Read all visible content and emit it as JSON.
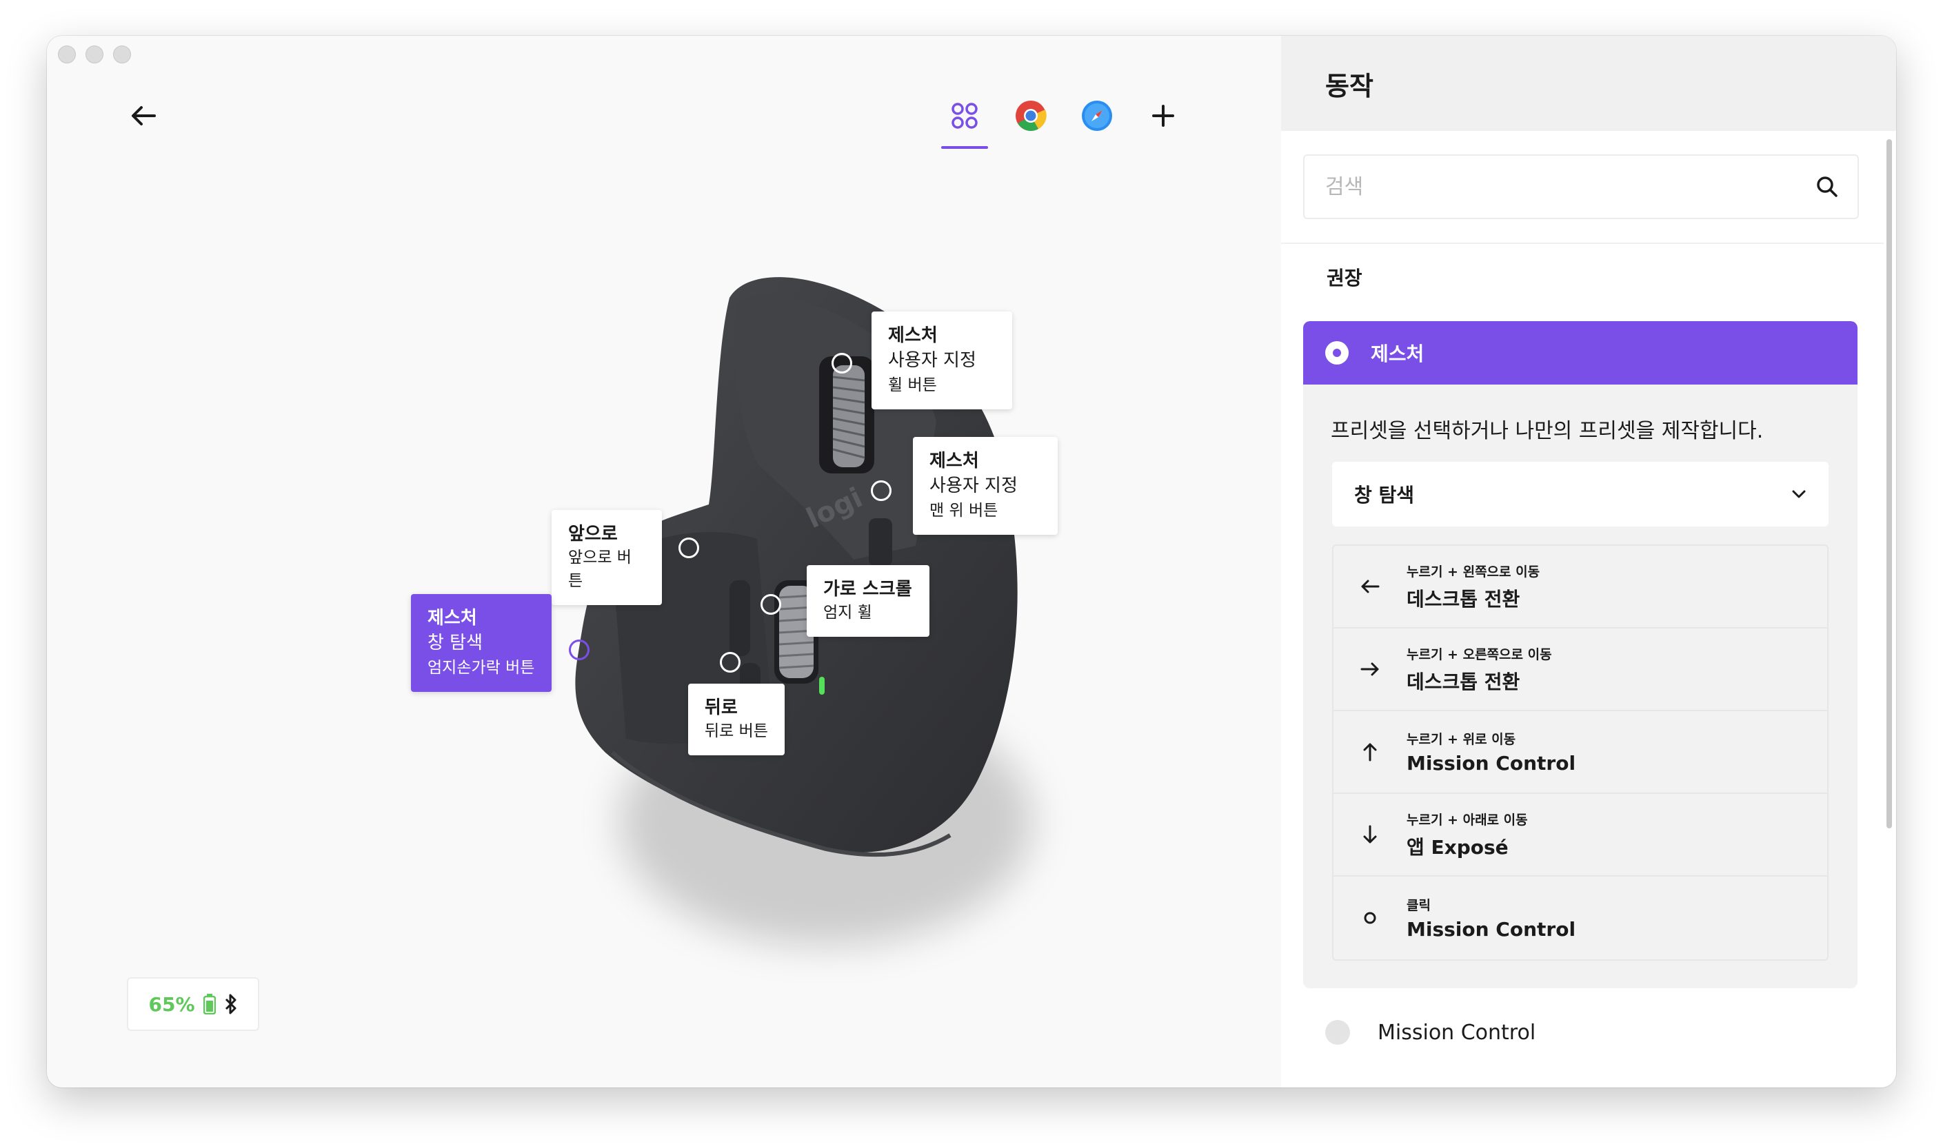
{
  "left_pane": {
    "callouts": {
      "wheel": {
        "title": "제스처",
        "subtitle": "사용자 지정",
        "desc": "휠 버튼"
      },
      "top_button": {
        "title": "제스처",
        "subtitle": "사용자 지정",
        "desc": "맨 위 버튼"
      },
      "forward": {
        "title": "앞으로",
        "desc": "앞으로 버튼"
      },
      "horizontal": {
        "title": "가로 스크롤",
        "desc": "엄지 휠"
      },
      "thumb": {
        "title": "제스처",
        "subtitle": "창 탐색",
        "desc": "엄지손가락 버튼"
      },
      "back": {
        "title": "뒤로",
        "desc": "뒤로 버튼"
      }
    },
    "mouse_logo": "logi",
    "battery": {
      "percent": "65%"
    }
  },
  "app_tabs": [
    {
      "name": "all-apps",
      "icon": "grid-icon",
      "active": true
    },
    {
      "name": "chrome",
      "icon": "chrome-icon"
    },
    {
      "name": "safari",
      "icon": "safari-icon"
    },
    {
      "name": "add",
      "icon": "plus-icon"
    }
  ],
  "right_pane": {
    "title": "동작",
    "search": {
      "placeholder": "검색"
    },
    "section_label": "권장",
    "gesture": {
      "label": "제스처",
      "description": "프리셋을 선택하거나 나만의 프리셋을 제작합니다.",
      "preset": "창 탐색",
      "actions": [
        {
          "hint": "누르기 + 왼쪽으로 이동",
          "label": "데스크톱 전환",
          "icon": "arrow-left-icon"
        },
        {
          "hint": "누르기 + 오른쪽으로 이동",
          "label": "데스크톱 전환",
          "icon": "arrow-right-icon"
        },
        {
          "hint": "누르기 + 위로 이동",
          "label": "Mission Control",
          "icon": "arrow-up-icon"
        },
        {
          "hint": "누르기 + 아래로 이동",
          "label": "앱 Exposé",
          "icon": "arrow-down-icon"
        },
        {
          "hint": "클릭",
          "label": "Mission Control",
          "icon": "circle-icon"
        }
      ]
    },
    "option": {
      "label": "Mission Control"
    }
  },
  "colors": {
    "accent": "#7a4fe8",
    "battery_green": "#5ec85a"
  }
}
